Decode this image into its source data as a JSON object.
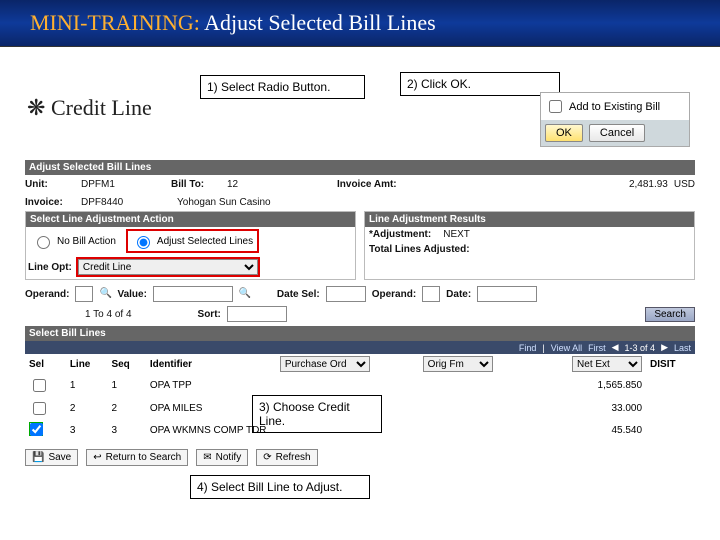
{
  "title": {
    "prefix": "MINI-TRAINING:",
    "rest": " Adjust Selected Bill Lines"
  },
  "callouts": {
    "c1": "1)   Select Radio Button.",
    "c2": "2) Click OK.",
    "c3": "3) Choose Credit Line.",
    "c4": "4) Select Bill Line to Adjust."
  },
  "ok_panel": {
    "add_label": "Add to Existing Bill",
    "ok": "OK",
    "cancel": "Cancel"
  },
  "credit_line_label": "Credit Line",
  "section_header": "Adjust Selected Bill Lines",
  "info": {
    "unit_label": "Unit:",
    "unit_val": "DPFM1",
    "billto_label": "Bill To:",
    "billto_val": "12",
    "invoice_amt_label": "Invoice Amt:",
    "invoice_amt_val": "2,481.93",
    "currency": "USD",
    "invoice_label": "Invoice:",
    "invoice_val": "DPF8440",
    "name_val": "Yohogan Sun Casino"
  },
  "left_col": {
    "hdr": "Select Line Adjustment Action",
    "no_bill": "No Bill Action",
    "adjust": "Adjust Selected Lines",
    "line_opt_label": "Line Opt:",
    "line_opt_val": "Credit Line"
  },
  "right_col": {
    "hdr": "Line Adjustment Results",
    "adjustment_label": "*Adjustment:",
    "adjustment_val": "NEXT",
    "total_label": "Total Lines Adjusted:"
  },
  "filter": {
    "operand_label": "Operand:",
    "value_label": "Value:",
    "date_sel_label": "Date Sel:",
    "operand2_label": "Operand:",
    "date_label": "Date:",
    "range_label": "1 To 4 of 4",
    "sort_label": "Sort:",
    "search_btn": "Search"
  },
  "bill_section_hdr": "Select Bill Lines",
  "pager": {
    "find": "Find",
    "viewall": "View All",
    "first": "First",
    "range": "1-3 of 4",
    "last": "Last"
  },
  "table": {
    "hdrs": {
      "sel": "Sel",
      "line": "Line",
      "seq": "Seq",
      "identifier": "Identifier",
      "po": "Purchase Ord",
      "orig": "Orig Fm",
      "netext": "Net Ext",
      "disit": "DISIT"
    },
    "rows": [
      {
        "sel": false,
        "line": "1",
        "seq": "1",
        "identifier": "OPA TPP",
        "netext": "1,565.850"
      },
      {
        "sel": false,
        "line": "2",
        "seq": "2",
        "identifier": "OPA MILES",
        "netext": "33.000"
      },
      {
        "sel": true,
        "line": "3",
        "seq": "3",
        "identifier": "OPA WKMNS COMP TDR",
        "netext": "45.540"
      }
    ]
  },
  "bottom": {
    "save": "Save",
    "return": "Return to Search",
    "notify": "Notify",
    "refresh": "Refresh"
  }
}
